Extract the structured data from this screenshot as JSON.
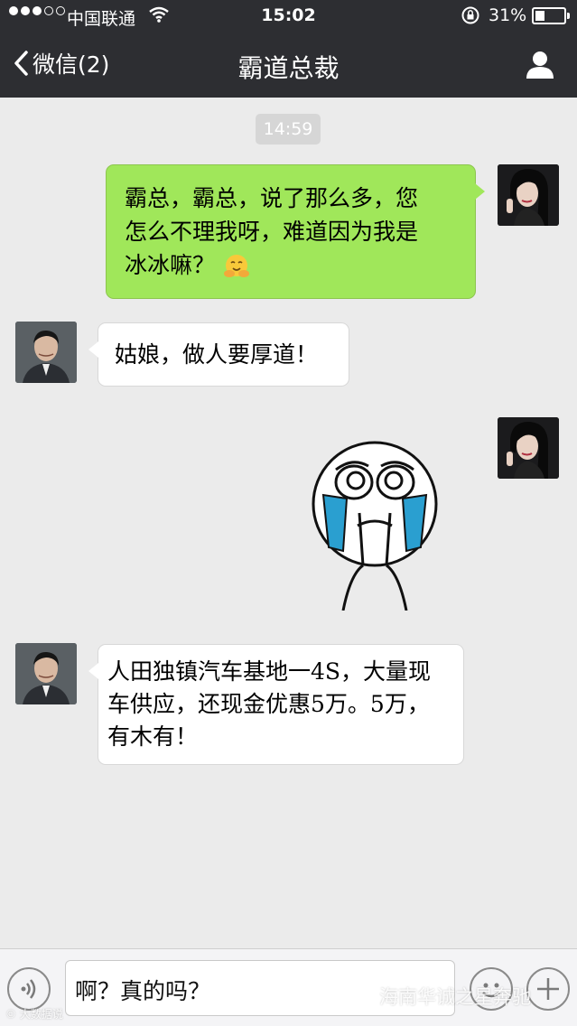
{
  "status_bar": {
    "carrier": "中国联通",
    "time": "15:02",
    "battery": "31%",
    "battery_level": 0.31
  },
  "nav": {
    "back_label": "微信(2)",
    "title": "霸道总裁"
  },
  "chat": {
    "timestamp": "14:59",
    "messages": [
      {
        "from": "me",
        "lines": [
          "霸总，霸总，说了那么多，您",
          "怎么不理我呀，难道因为我是",
          "冰冰嘛？"
        ],
        "emoji": "hugging-face-emoji"
      },
      {
        "from": "other",
        "lines": [
          "姑娘，做人要厚道！"
        ]
      },
      {
        "from": "me",
        "sticker": "crying-rage-face-sticker"
      },
      {
        "from": "other",
        "lines": [
          "人田独镇汽车基地一4S，大量现",
          "车供应，还现金优惠5万。5万，",
          "有木有！"
        ]
      }
    ]
  },
  "input": {
    "value": "啊？真的吗？"
  },
  "watermark": {
    "right": "海南华诚之星奔驰",
    "left": "© 大数据说"
  },
  "colors": {
    "header": "#2d2e32",
    "outgoing_bubble": "#a0e75a",
    "incoming_bubble": "#ffffff",
    "background": "#ebebeb"
  }
}
